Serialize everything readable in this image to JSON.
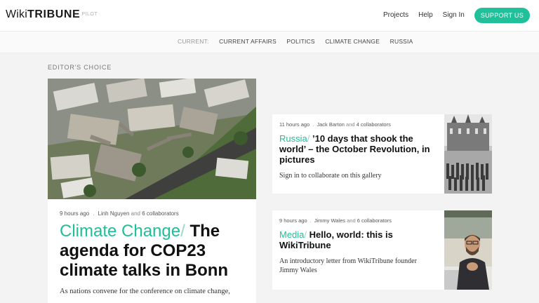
{
  "header": {
    "logo_wiki": "Wiki",
    "logo_tribune": "TRIBUNE",
    "logo_pilot": "PILOT",
    "nav": {
      "projects": "Projects",
      "help": "Help",
      "sign_in": "Sign In"
    },
    "support_label": "SUPPORT US"
  },
  "categories": {
    "current_label": "CURRENT:",
    "items": [
      "CURRENT AFFAIRS",
      "POLITICS",
      "CLIMATE CHANGE",
      "RUSSIA"
    ]
  },
  "section_title": "EDITOR'S CHOICE",
  "feature": {
    "time": "9 hours ago",
    "author": "Linh Nguyen",
    "and": "and",
    "collaborators": "6 collaborators",
    "category": "Climate Change",
    "slash": "/",
    "title": "The agenda for COP23 climate talks in Bonn",
    "excerpt": "As nations convene for the conference on climate change,"
  },
  "cards": [
    {
      "time": "11 hours ago",
      "author": "Jack Barton",
      "and": "and",
      "collaborators": "4 collaborators",
      "category": "Russia",
      "slash": "/",
      "title": "’10 days that shook the world’ – the October Revolution, in pictures",
      "excerpt": "Sign in to collaborate on this gallery"
    },
    {
      "time": "9 hours ago",
      "author": "Jimmy Wales",
      "and": "and",
      "collaborators": "6 collaborators",
      "category": "Media",
      "slash": "/",
      "title": "Hello, world: this is WikiTribune",
      "excerpt": "An introductory letter from WikiTribune founder Jimmy Wales"
    }
  ],
  "meta_dot": ".",
  "colors": {
    "accent": "#1fc09a",
    "background": "#f3f3f3"
  }
}
